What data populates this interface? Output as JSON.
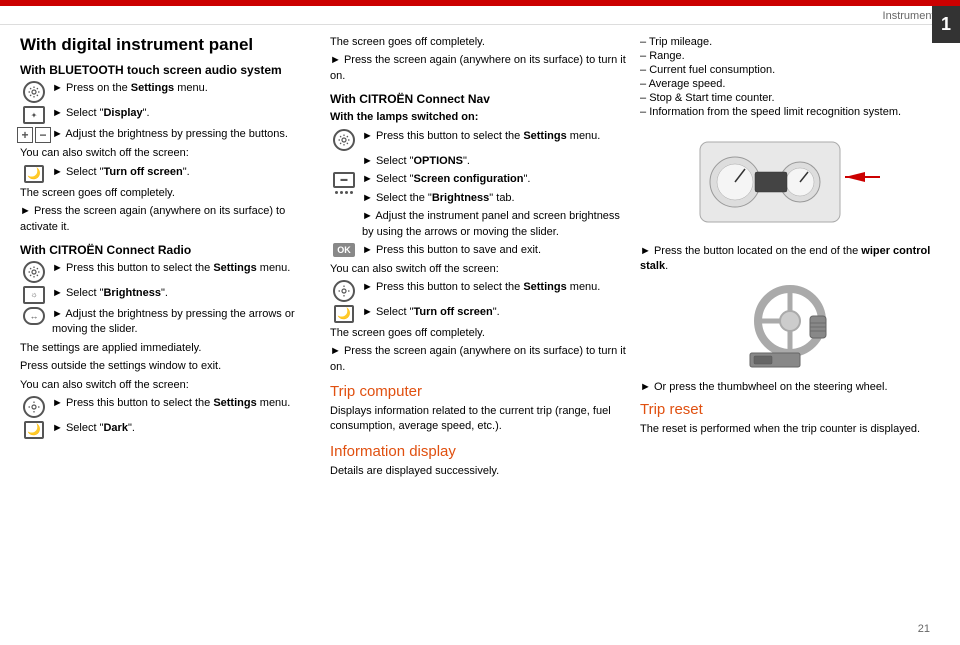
{
  "header": {
    "title": "Instruments",
    "chapter_number": "1"
  },
  "left_column": {
    "main_title": "With digital instrument panel",
    "bluetooth_section": {
      "heading": "With BLUETOOTH touch screen audio system",
      "steps": [
        {
          "icon": "settings",
          "text": "Press on the **Settings** menu."
        },
        {
          "icon": "display",
          "text": "Select \"**Display**\"."
        },
        {
          "icon": "plus-minus",
          "text": "Adjust the brightness by pressing the buttons."
        },
        {
          "text_plain": "You can also switch off the screen:"
        },
        {
          "icon": "moon",
          "text": "Select \"**Turn off screen**\"."
        }
      ],
      "after_steps": [
        "The screen goes off completely.",
        "► Press the screen again (anywhere on its surface) to activate it."
      ]
    },
    "connect_radio_section": {
      "heading": "With CITROËN Connect Radio",
      "steps": [
        {
          "icon": "settings",
          "text": "Press this button to select the **Settings** menu."
        },
        {
          "icon": "citroen",
          "text": "Select \"**Brightness**\"."
        },
        {
          "icon": "arrows",
          "text": "Adjust the brightness by pressing the arrows or moving the slider."
        },
        {
          "text_plain": "The settings are applied immediately."
        },
        {
          "text_plain": "Press outside the settings window to exit."
        },
        {
          "text_plain": "You can also switch off the screen:"
        },
        {
          "icon": "settings",
          "text": "Press this button to select the **Settings** menu."
        },
        {
          "icon": "moon",
          "text": "Select \"**Dark**\"."
        }
      ]
    }
  },
  "middle_column": {
    "intro": "The screen goes off completely.",
    "intro2": "► Press the screen again (anywhere on its surface) to turn it on.",
    "connect_nav_section": {
      "heading": "With CITROËN Connect Nav",
      "lamps_on": "With the lamps switched on:",
      "steps": [
        {
          "icon": "settings",
          "text": "Press this button to select the **Settings** menu."
        },
        {
          "text": "Select \"**OPTIONS**\"."
        },
        {
          "icon": "display2",
          "text": "Select \"**Screen configuration**\"."
        },
        {
          "text": "Select the \"**Brightness**\" tab."
        },
        {
          "text": "Adjust the instrument panel and screen brightness by using the arrows or moving the slider."
        },
        {
          "icon": "ok",
          "text": "Press this button to save and exit."
        }
      ],
      "after": [
        "You can also switch off the screen:",
        {
          "icon": "settings",
          "text": "Press this button to select the **Settings** menu."
        },
        {
          "icon": "moon",
          "text": "Select \"**Turn off screen**\"."
        }
      ]
    },
    "after_nav": [
      "The screen goes off completely.",
      "► Press the screen again (anywhere on its surface) to turn it on."
    ],
    "trip_computer": {
      "heading": "Trip computer",
      "text": "Displays information related to the current trip (range, fuel consumption, average speed, etc.)."
    },
    "information_display": {
      "heading": "Information display",
      "text": "Details are displayed successively."
    }
  },
  "right_column": {
    "list_items": [
      "Trip mileage.",
      "Range.",
      "Current fuel consumption.",
      "Average speed.",
      "Stop & Start time counter.",
      "Information from the speed limit recognition system."
    ],
    "wiper_text": "► Press the button located on the end of the **wiper control stalk**.",
    "thumbwheel_text": "► Or press the thumbwheel on the steering wheel.",
    "trip_reset": {
      "heading": "Trip reset",
      "text": "The reset is performed when the trip counter is displayed."
    }
  },
  "page_number": "21"
}
